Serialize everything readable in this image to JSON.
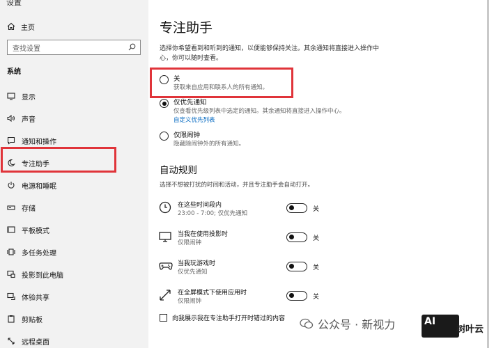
{
  "sidebar": {
    "window_title": "设置",
    "home_label": "主页",
    "search_placeholder": "查找设置",
    "section_label": "系统",
    "items": [
      {
        "label": "显示",
        "icon": "monitor-icon"
      },
      {
        "label": "声音",
        "icon": "speaker-icon"
      },
      {
        "label": "通知和操作",
        "icon": "notification-icon"
      },
      {
        "label": "专注助手",
        "icon": "moon-icon"
      },
      {
        "label": "电源和睡眠",
        "icon": "power-icon"
      },
      {
        "label": "存储",
        "icon": "storage-icon"
      },
      {
        "label": "平板模式",
        "icon": "tablet-icon"
      },
      {
        "label": "多任务处理",
        "icon": "multitask-icon"
      },
      {
        "label": "投影到此电脑",
        "icon": "project-icon"
      },
      {
        "label": "体验共享",
        "icon": "share-icon"
      },
      {
        "label": "剪贴板",
        "icon": "clipboard-icon"
      },
      {
        "label": "远程桌面",
        "icon": "remote-icon"
      }
    ]
  },
  "main": {
    "title": "专注助手",
    "description": "选择你希望看到和听到的通知，以便能够保持关注。其余通知将直接进入操作中心，你可以随时查看。",
    "options": [
      {
        "title": "关",
        "subtitle": "获取来自应用和联系人的所有通知。",
        "checked": false
      },
      {
        "title": "仅优先通知",
        "subtitle": "仅查看优先级列表中选定的通知。其余通知将直接进入操作中心。",
        "link": "自定义优先列表",
        "checked": true
      },
      {
        "title": "仅限闹钟",
        "subtitle": "隐藏除闹钟外的所有通知。",
        "checked": false
      }
    ],
    "auto_rules_title": "自动规则",
    "auto_rules_desc": "选择不想被打扰的时间和活动，并且专注助手会自动打开。",
    "rules": [
      {
        "title": "在这些时间段内",
        "subtitle": "23:00 - 7:00; 仅优先通知",
        "state": "关",
        "icon": "clock-icon"
      },
      {
        "title": "当我在使用投影时",
        "subtitle": "仅限闹钟",
        "state": "关",
        "icon": "projector-icon"
      },
      {
        "title": "当我玩游戏时",
        "subtitle": "仅优先通知",
        "state": "关",
        "icon": "gamepad-icon"
      },
      {
        "title": "在全屏模式下使用应用时",
        "subtitle": "仅限闹钟",
        "state": "关",
        "icon": "fullscreen-icon"
      }
    ],
    "checkbox_label": "向我展示我在专注助手打开时错过的内容"
  },
  "watermark": {
    "text": "公众号 · 新视力",
    "logo": "AI",
    "brand": "树叶云"
  },
  "colors": {
    "highlight": "#e0343a",
    "link": "#0067c0",
    "sidebar_bg": "#f2f2f2"
  }
}
